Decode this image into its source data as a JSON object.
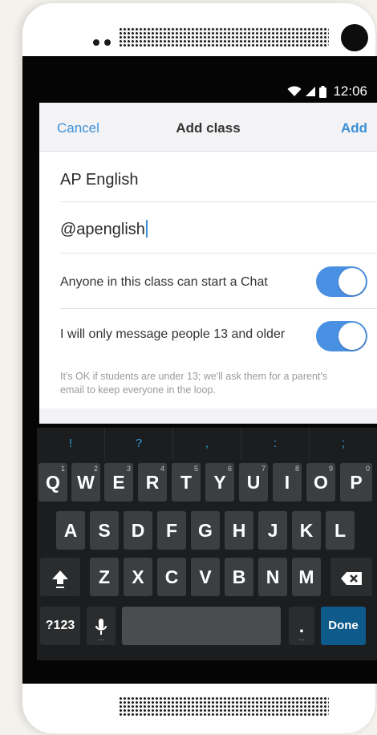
{
  "status": {
    "time": "12:06"
  },
  "dialog": {
    "cancel": "Cancel",
    "title": "Add class",
    "add": "Add",
    "class_name": "AP English",
    "class_handle": "@apenglish",
    "chat_label": "Anyone in this class can start a Chat",
    "chat_enabled": true,
    "age_label": "I will only message people 13 and older",
    "age_enabled": true,
    "age_note": "It's OK if students are under 13; we'll ask them for a parent's email to keep everyone in the loop."
  },
  "keyboard": {
    "hints": [
      "!",
      "?",
      ",",
      ":",
      ";"
    ],
    "row1": [
      {
        "key": "Q",
        "sup": "1"
      },
      {
        "key": "W",
        "sup": "2"
      },
      {
        "key": "E",
        "sup": "3"
      },
      {
        "key": "R",
        "sup": "4"
      },
      {
        "key": "T",
        "sup": "5"
      },
      {
        "key": "Y",
        "sup": "6"
      },
      {
        "key": "U",
        "sup": "7"
      },
      {
        "key": "I",
        "sup": "8"
      },
      {
        "key": "O",
        "sup": "9"
      },
      {
        "key": "P",
        "sup": "0"
      }
    ],
    "row2": [
      "A",
      "S",
      "D",
      "F",
      "G",
      "H",
      "J",
      "K",
      "L"
    ],
    "row3": [
      "Z",
      "X",
      "C",
      "V",
      "B",
      "N",
      "M"
    ],
    "symbols_label": "?123",
    "period": ".",
    "done_label": "Done"
  },
  "colors": {
    "accent": "#3b8fd6",
    "toggle_on": "#4a90e2",
    "done_key": "#0e5a8a"
  }
}
